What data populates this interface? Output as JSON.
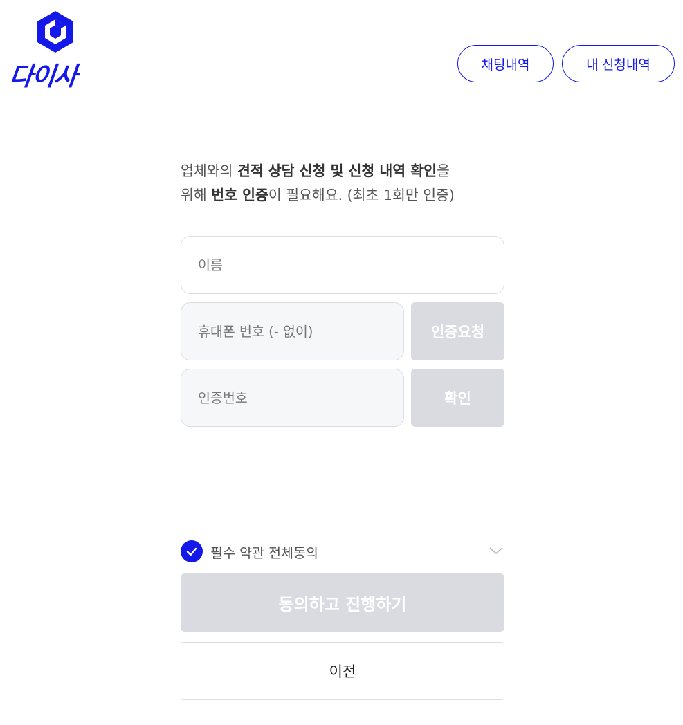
{
  "brand": {
    "logo_text": "다이사",
    "color": "#1418e8"
  },
  "header": {
    "chat_history": "채팅내역",
    "my_requests": "내 신청내역"
  },
  "intro": {
    "line1_pre": "업체와의 ",
    "line1_bold": "견적 상담 신청 및 신청 내역 확인",
    "line1_post": "을",
    "line2_pre": "위해 ",
    "line2_bold": "번호 인증",
    "line2_post": "이 필요해요. (최초 1회만 인증)"
  },
  "form": {
    "name_placeholder": "이름",
    "phone_placeholder": "휴대폰 번호 (- 없이)",
    "request_code_label": "인증요청",
    "code_placeholder": "인증번호",
    "confirm_label": "확인"
  },
  "agreement": {
    "label": "필수 약관 전체동의",
    "checked": true
  },
  "actions": {
    "proceed_label": "동의하고 진행하기",
    "prev_label": "이전"
  },
  "colors": {
    "accent": "#1418e8",
    "disabled": "#d9dbe1"
  }
}
